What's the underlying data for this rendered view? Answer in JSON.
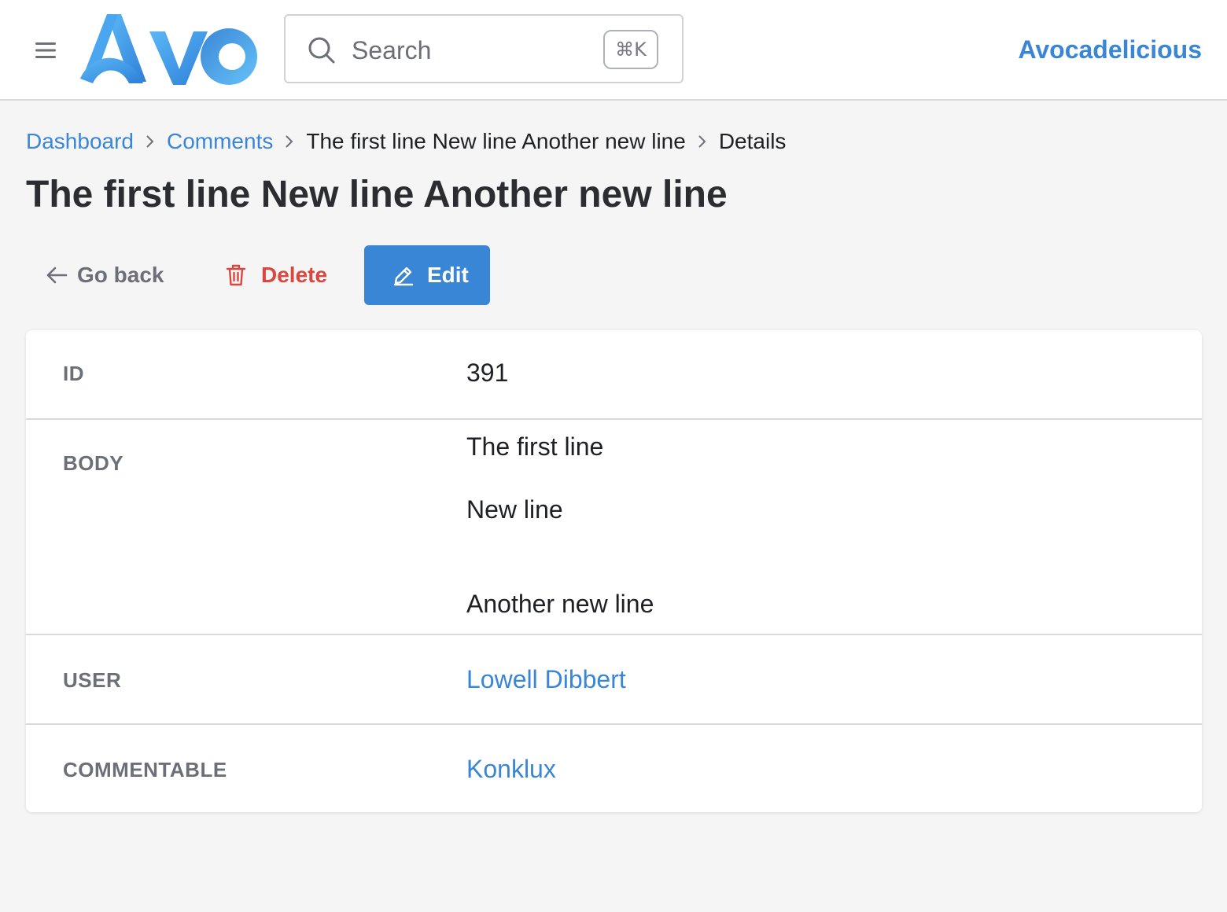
{
  "header": {
    "logo_text": "AVO",
    "search_placeholder": "Search",
    "search_shortcut": "⌘K",
    "account_name": "Avocadelicious"
  },
  "breadcrumb": {
    "items": [
      "Dashboard",
      "Comments",
      "The first line New line Another new line",
      "Details"
    ]
  },
  "page": {
    "title": "The first line New line Another new line"
  },
  "actions": {
    "back_label": "Go back",
    "delete_label": "Delete",
    "edit_label": "Edit"
  },
  "fields": {
    "id": {
      "label": "ID",
      "value": "391"
    },
    "body": {
      "label": "BODY",
      "lines": [
        "The first line",
        "New line",
        "Another new line"
      ]
    },
    "user": {
      "label": "USER",
      "value": "Lowell Dibbert"
    },
    "commentable": {
      "label": "COMMENTABLE",
      "value": "Konklux"
    }
  },
  "colors": {
    "accent": "#3a86d6",
    "danger": "#d9473f",
    "muted": "#6b6f78",
    "background": "#f5f5f5"
  },
  "icons": [
    "menu-icon",
    "search-icon",
    "arrow-left-icon",
    "trash-icon",
    "pencil-icon",
    "chevron-right-icon"
  ]
}
